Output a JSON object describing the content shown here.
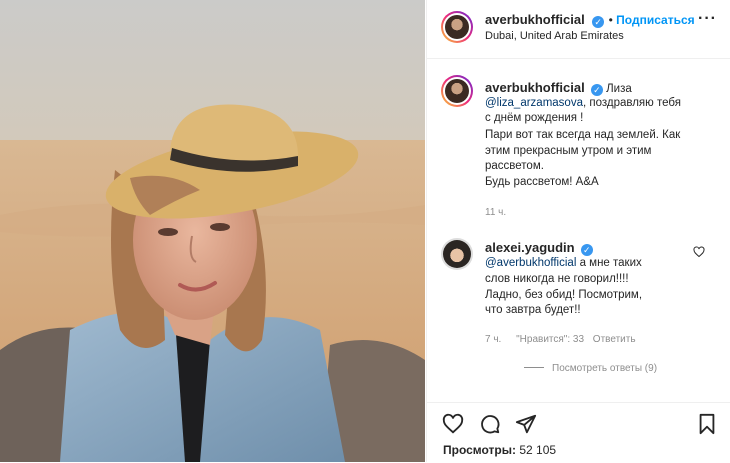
{
  "header": {
    "username": "averbukhofficial",
    "follow_label": "Подписаться",
    "location": "Dubai, United Arab Emirates",
    "more_icon": "ellipsis-icon"
  },
  "caption": {
    "username": "averbukhofficial",
    "greeting": "Лиза",
    "mention": "@liza_arzamasova",
    "line1_rest": ", поздравляю тебя",
    "line2": "с днём рождения !",
    "line3": "Пари вот так всегда над землей. Как",
    "line4": "этим прекрасным утром и этим",
    "line5": "рассветом.",
    "line6": "Будь рассветом! А&А",
    "time": "11 ч."
  },
  "comment": {
    "username": "alexei.yagudin",
    "mention": "@averbukhofficial",
    "line1_rest": " а мне таких",
    "line2": "слов никогда не говорил!!!!",
    "line3": "Ладно, без обид! Посмотрим,",
    "line4": "что завтра будет!!",
    "time": "7 ч.",
    "likes": "\"Нравится\": 33",
    "reply_label": "Ответить",
    "view_replies": "Посмотреть ответы (9)"
  },
  "footer": {
    "views_label": "Просмотры:",
    "views_count": "52 105"
  },
  "icons": {
    "like": "heart-icon",
    "comment": "comment-icon",
    "share": "share-icon",
    "save": "bookmark-icon",
    "verified": "verified-badge-icon"
  }
}
